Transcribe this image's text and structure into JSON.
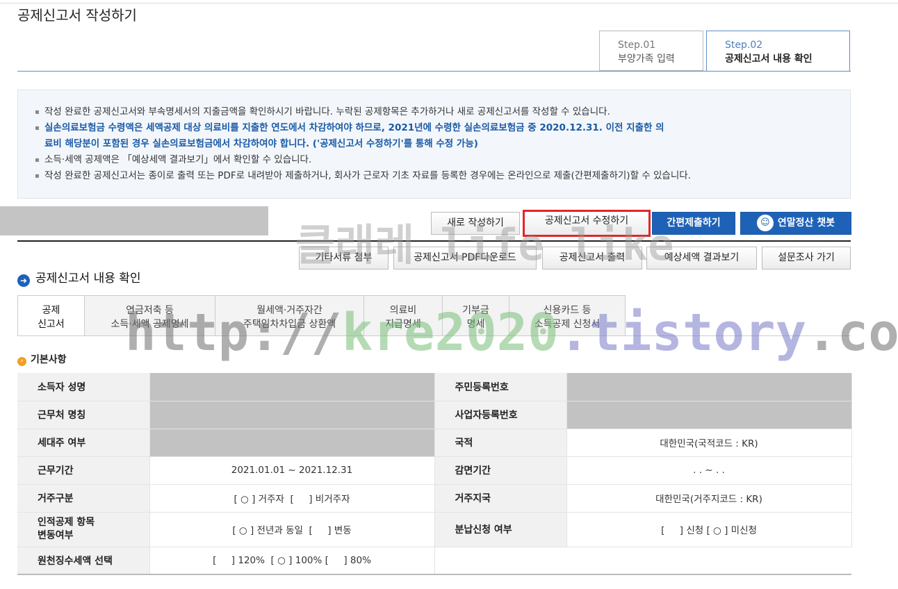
{
  "page_title": "공제신고서 작성하기",
  "steps": [
    {
      "num": "Step.01",
      "label": "부양가족 입력"
    },
    {
      "num": "Step.02",
      "label": "공제신고서 내용 확인"
    }
  ],
  "notice": [
    "작성 완료한 공제신고서와 부속명세서의 지출금액을 확인하시기 바랍니다. 누락된 공제항목은 추가하거나 새로 공제신고서를 작성할 수 있습니다.",
    "실손의료보험금 수령액은 세액공제 대상 의료비를 지출한 연도에서 차감하여야 하므로, 2021년에 수령한 실손의료보험금 중 2020.12.31. 이전 지출한 의",
    "료비 해당분이 포함된 경우 실손의료보험금에서 차감하여야 합니다. ('공제신고서 수정하기'를 통해 수정 가능)",
    "소득·세액 공제액은 「예상세액 결과보기」에서 확인할 수 있습니다.",
    "작성 완료한 공제신고서는 종이로 출력 또는 PDF로 내려받아 제출하거나, 회사가 근로자 기초 자료를 등록한 경우에는 온라인으로 제출(간편제출하기)할 수 있습니다."
  ],
  "toolbar1": {
    "new": "새로 작성하기",
    "edit": "공제신고서 수정하기",
    "submit": "간편제출하기",
    "chatbot": "연말정산 챗봇"
  },
  "toolbar2": {
    "attach": "기타서류 첨부",
    "pdf": "공제신고서 PDF다운로드",
    "print": "공제신고서 출력",
    "estimate": "예상세액 결과보기",
    "survey": "설문조사 가기"
  },
  "section_title": "공제신고서 내용 확인",
  "tabs": [
    {
      "l1": "공제",
      "l2": "신고서"
    },
    {
      "l1": "연금저축 등",
      "l2": "소득·세액 공제명세"
    },
    {
      "l1": "월세액·거주자간",
      "l2": "주택임차차입금 상환액"
    },
    {
      "l1": "의료비",
      "l2": "지급명세"
    },
    {
      "l1": "기부금",
      "l2": "명세"
    },
    {
      "l1": "신용카드 등",
      "l2": "소득공제 신청서"
    }
  ],
  "basic_title": "기본사항",
  "labels": {
    "name": "소득자 성명",
    "rrn": "주민등록번호",
    "company": "근무처 명칭",
    "bizno": "사업자등록번호",
    "household": "세대주 여부",
    "nationality": "국적",
    "period": "근무기간",
    "exempt_period": "감면기간",
    "residency": "거주구분",
    "residence_country": "거주지국",
    "personal_l1": "인적공제 항목",
    "personal_l2": "변동여부",
    "installment": "분납신청 여부",
    "withholding": "원천징수세액 선택"
  },
  "values": {
    "nationality": "대한민국(국적코드 : KR)",
    "period": "2021.01.01 ~ 2021.12.31",
    "exempt_period": ". . ~ . .",
    "residency": "[ ○ ] 거주자  [     ] 비거주자",
    "residence_country": "대한민국(거주지코드 : KR)",
    "personal": "[ ○ ] 전년과 동일  [     ] 변동",
    "installment": "[     ] 신청 [ ○ ] 미신청",
    "withholding": "[     ] 120%  [ ○ ] 100% [     ] 80%"
  },
  "watermark": {
    "w1": "클래레 life like",
    "w2a": "http://",
    "w2b": "kre2020",
    "w2c": ".tistory",
    "w2d": ".com"
  }
}
